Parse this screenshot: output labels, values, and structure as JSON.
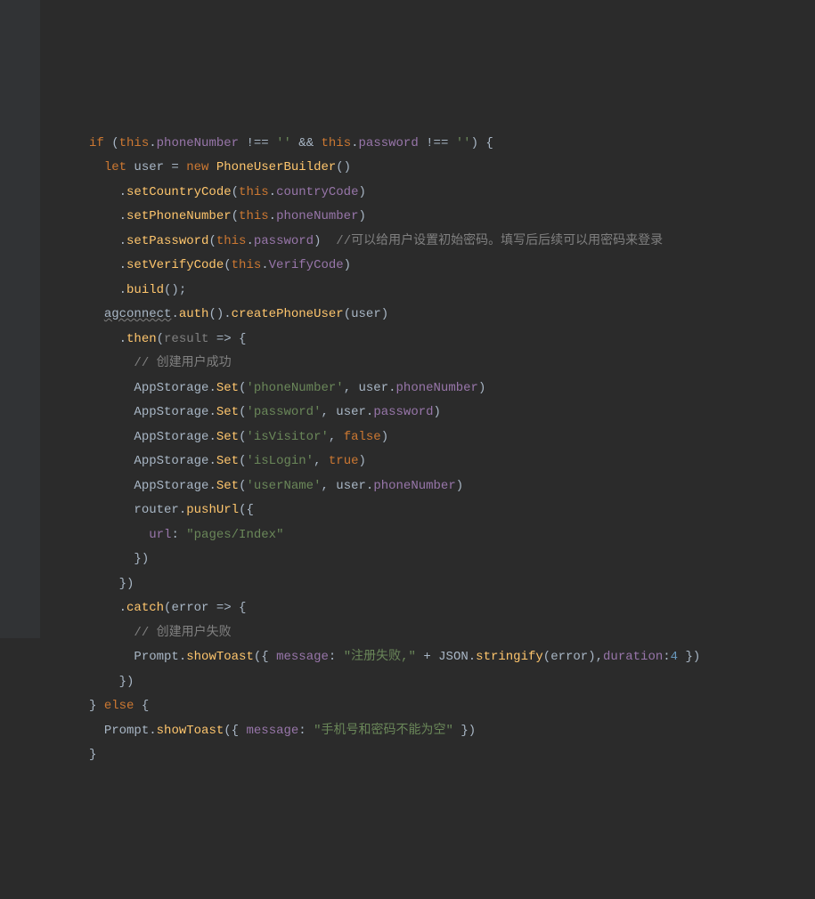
{
  "code": {
    "lines": [
      {
        "indent": 0,
        "tokens": [
          {
            "t": "if ",
            "c": "kw"
          },
          {
            "t": "(",
            "c": "punct"
          },
          {
            "t": "this",
            "c": "this"
          },
          {
            "t": ".",
            "c": "punct"
          },
          {
            "t": "phoneNumber",
            "c": "prop"
          },
          {
            "t": " !== ",
            "c": "punct"
          },
          {
            "t": "''",
            "c": "str"
          },
          {
            "t": " && ",
            "c": "punct"
          },
          {
            "t": "this",
            "c": "this"
          },
          {
            "t": ".",
            "c": "punct"
          },
          {
            "t": "password",
            "c": "prop"
          },
          {
            "t": " !== ",
            "c": "punct"
          },
          {
            "t": "''",
            "c": "str"
          },
          {
            "t": ") {",
            "c": "punct"
          }
        ]
      },
      {
        "indent": 1,
        "tokens": [
          {
            "t": "let ",
            "c": "kw"
          },
          {
            "t": "user",
            "c": "param"
          },
          {
            "t": " = ",
            "c": "punct"
          },
          {
            "t": "new ",
            "c": "new"
          },
          {
            "t": "PhoneUserBuilder",
            "c": "type"
          },
          {
            "t": "()",
            "c": "punct"
          }
        ]
      },
      {
        "indent": 2,
        "tokens": [
          {
            "t": ".",
            "c": "punct"
          },
          {
            "t": "setCountryCode",
            "c": "method"
          },
          {
            "t": "(",
            "c": "punct"
          },
          {
            "t": "this",
            "c": "this"
          },
          {
            "t": ".",
            "c": "punct"
          },
          {
            "t": "countryCode",
            "c": "prop"
          },
          {
            "t": ")",
            "c": "punct"
          }
        ]
      },
      {
        "indent": 2,
        "tokens": [
          {
            "t": ".",
            "c": "punct"
          },
          {
            "t": "setPhoneNumber",
            "c": "method"
          },
          {
            "t": "(",
            "c": "punct"
          },
          {
            "t": "this",
            "c": "this"
          },
          {
            "t": ".",
            "c": "punct"
          },
          {
            "t": "phoneNumber",
            "c": "prop"
          },
          {
            "t": ")",
            "c": "punct"
          }
        ]
      },
      {
        "indent": 2,
        "tokens": [
          {
            "t": ".",
            "c": "punct"
          },
          {
            "t": "setPassword",
            "c": "method"
          },
          {
            "t": "(",
            "c": "punct"
          },
          {
            "t": "this",
            "c": "this"
          },
          {
            "t": ".",
            "c": "punct"
          },
          {
            "t": "password",
            "c": "prop"
          },
          {
            "t": ")",
            "c": "punct"
          },
          {
            "t": "  //可以给用户设置初始密码。填写后后续可以用密码来登录",
            "c": "comment"
          }
        ]
      },
      {
        "indent": 2,
        "tokens": [
          {
            "t": ".",
            "c": "punct"
          },
          {
            "t": "setVerifyCode",
            "c": "method"
          },
          {
            "t": "(",
            "c": "punct"
          },
          {
            "t": "this",
            "c": "this"
          },
          {
            "t": ".",
            "c": "punct"
          },
          {
            "t": "VerifyCode",
            "c": "prop"
          },
          {
            "t": ")",
            "c": "punct"
          }
        ]
      },
      {
        "indent": 2,
        "tokens": [
          {
            "t": ".",
            "c": "punct"
          },
          {
            "t": "build",
            "c": "method"
          },
          {
            "t": "();",
            "c": "punct"
          }
        ]
      },
      {
        "indent": 1,
        "tokens": [
          {
            "t": "agconnect",
            "c": "squiggle"
          },
          {
            "t": ".",
            "c": "punct"
          },
          {
            "t": "auth",
            "c": "method"
          },
          {
            "t": "().",
            "c": "punct"
          },
          {
            "t": "createPhoneUser",
            "c": "method"
          },
          {
            "t": "(",
            "c": "punct"
          },
          {
            "t": "user",
            "c": "param"
          },
          {
            "t": ")",
            "c": "punct"
          }
        ]
      },
      {
        "indent": 2,
        "tokens": [
          {
            "t": ".",
            "c": "punct"
          },
          {
            "t": "then",
            "c": "method"
          },
          {
            "t": "(",
            "c": "punct"
          },
          {
            "t": "result",
            "c": "comment"
          },
          {
            "t": " => {",
            "c": "punct"
          }
        ]
      },
      {
        "indent": 3,
        "tokens": [
          {
            "t": "// 创建用户成功",
            "c": "comment"
          }
        ]
      },
      {
        "indent": 3,
        "tokens": [
          {
            "t": "AppStorage",
            "c": "cls"
          },
          {
            "t": ".",
            "c": "punct"
          },
          {
            "t": "Set",
            "c": "method"
          },
          {
            "t": "(",
            "c": "punct"
          },
          {
            "t": "'phoneNumber'",
            "c": "str"
          },
          {
            "t": ", ",
            "c": "punct"
          },
          {
            "t": "user",
            "c": "param"
          },
          {
            "t": ".",
            "c": "punct"
          },
          {
            "t": "phoneNumber",
            "c": "prop"
          },
          {
            "t": ")",
            "c": "punct"
          }
        ]
      },
      {
        "indent": 3,
        "tokens": [
          {
            "t": "AppStorage",
            "c": "cls"
          },
          {
            "t": ".",
            "c": "punct"
          },
          {
            "t": "Set",
            "c": "method"
          },
          {
            "t": "(",
            "c": "punct"
          },
          {
            "t": "'password'",
            "c": "str"
          },
          {
            "t": ", ",
            "c": "punct"
          },
          {
            "t": "user",
            "c": "param"
          },
          {
            "t": ".",
            "c": "punct"
          },
          {
            "t": "password",
            "c": "prop"
          },
          {
            "t": ")",
            "c": "punct"
          }
        ]
      },
      {
        "indent": 3,
        "tokens": [
          {
            "t": "AppStorage",
            "c": "cls"
          },
          {
            "t": ".",
            "c": "punct"
          },
          {
            "t": "Set",
            "c": "method"
          },
          {
            "t": "(",
            "c": "punct"
          },
          {
            "t": "'isVisitor'",
            "c": "str"
          },
          {
            "t": ", ",
            "c": "punct"
          },
          {
            "t": "false",
            "c": "bool"
          },
          {
            "t": ")",
            "c": "punct"
          }
        ]
      },
      {
        "indent": 3,
        "tokens": [
          {
            "t": "AppStorage",
            "c": "cls"
          },
          {
            "t": ".",
            "c": "punct"
          },
          {
            "t": "Set",
            "c": "method"
          },
          {
            "t": "(",
            "c": "punct"
          },
          {
            "t": "'isLogin'",
            "c": "str"
          },
          {
            "t": ", ",
            "c": "punct"
          },
          {
            "t": "true",
            "c": "bool"
          },
          {
            "t": ")",
            "c": "punct"
          }
        ]
      },
      {
        "indent": 3,
        "tokens": [
          {
            "t": "AppStorage",
            "c": "cls"
          },
          {
            "t": ".",
            "c": "punct"
          },
          {
            "t": "Set",
            "c": "method"
          },
          {
            "t": "(",
            "c": "punct"
          },
          {
            "t": "'userName'",
            "c": "str"
          },
          {
            "t": ", ",
            "c": "punct"
          },
          {
            "t": "user",
            "c": "param"
          },
          {
            "t": ".",
            "c": "punct"
          },
          {
            "t": "phoneNumber",
            "c": "prop"
          },
          {
            "t": ")",
            "c": "punct"
          }
        ]
      },
      {
        "indent": 3,
        "tokens": [
          {
            "t": "router",
            "c": "cls"
          },
          {
            "t": ".",
            "c": "punct"
          },
          {
            "t": "pushUrl",
            "c": "method"
          },
          {
            "t": "({",
            "c": "punct"
          }
        ]
      },
      {
        "indent": 4,
        "tokens": [
          {
            "t": "url",
            "c": "prop"
          },
          {
            "t": ": ",
            "c": "punct"
          },
          {
            "t": "\"pages/Index\"",
            "c": "str"
          }
        ]
      },
      {
        "indent": 3,
        "tokens": [
          {
            "t": "})",
            "c": "punct"
          }
        ]
      },
      {
        "indent": 2,
        "tokens": [
          {
            "t": "})",
            "c": "punct"
          }
        ]
      },
      {
        "indent": 2,
        "tokens": [
          {
            "t": ".",
            "c": "punct"
          },
          {
            "t": "catch",
            "c": "method"
          },
          {
            "t": "(",
            "c": "punct"
          },
          {
            "t": "error",
            "c": "param"
          },
          {
            "t": " => {",
            "c": "punct"
          }
        ]
      },
      {
        "indent": 3,
        "tokens": [
          {
            "t": "// 创建用户失败",
            "c": "comment"
          }
        ]
      },
      {
        "indent": 3,
        "tokens": [
          {
            "t": "Prompt",
            "c": "cls"
          },
          {
            "t": ".",
            "c": "punct"
          },
          {
            "t": "showToast",
            "c": "method"
          },
          {
            "t": "({ ",
            "c": "punct"
          },
          {
            "t": "message",
            "c": "prop"
          },
          {
            "t": ": ",
            "c": "punct"
          },
          {
            "t": "\"注册失败,\"",
            "c": "str"
          },
          {
            "t": " + ",
            "c": "punct"
          },
          {
            "t": "JSON",
            "c": "cls"
          },
          {
            "t": ".",
            "c": "punct"
          },
          {
            "t": "stringify",
            "c": "method"
          },
          {
            "t": "(",
            "c": "punct"
          },
          {
            "t": "error",
            "c": "param"
          },
          {
            "t": "),",
            "c": "punct"
          },
          {
            "t": "duration",
            "c": "prop"
          },
          {
            "t": ":",
            "c": "punct"
          },
          {
            "t": "4",
            "c": "num"
          },
          {
            "t": " })",
            "c": "punct"
          }
        ]
      },
      {
        "indent": 2,
        "tokens": [
          {
            "t": "})",
            "c": "punct"
          }
        ]
      },
      {
        "indent": 0,
        "tokens": [
          {
            "t": "} ",
            "c": "punct"
          },
          {
            "t": "else",
            "c": "kw"
          },
          {
            "t": " {",
            "c": "punct"
          }
        ]
      },
      {
        "indent": 1,
        "tokens": [
          {
            "t": "Prompt",
            "c": "cls"
          },
          {
            "t": ".",
            "c": "punct"
          },
          {
            "t": "showToast",
            "c": "method"
          },
          {
            "t": "({ ",
            "c": "punct"
          },
          {
            "t": "message",
            "c": "prop"
          },
          {
            "t": ": ",
            "c": "punct"
          },
          {
            "t": "\"手机号和密码不能为空\"",
            "c": "str"
          },
          {
            "t": " })",
            "c": "punct"
          }
        ]
      },
      {
        "indent": 0,
        "tokens": [
          {
            "t": "}",
            "c": "punct"
          }
        ]
      }
    ]
  }
}
